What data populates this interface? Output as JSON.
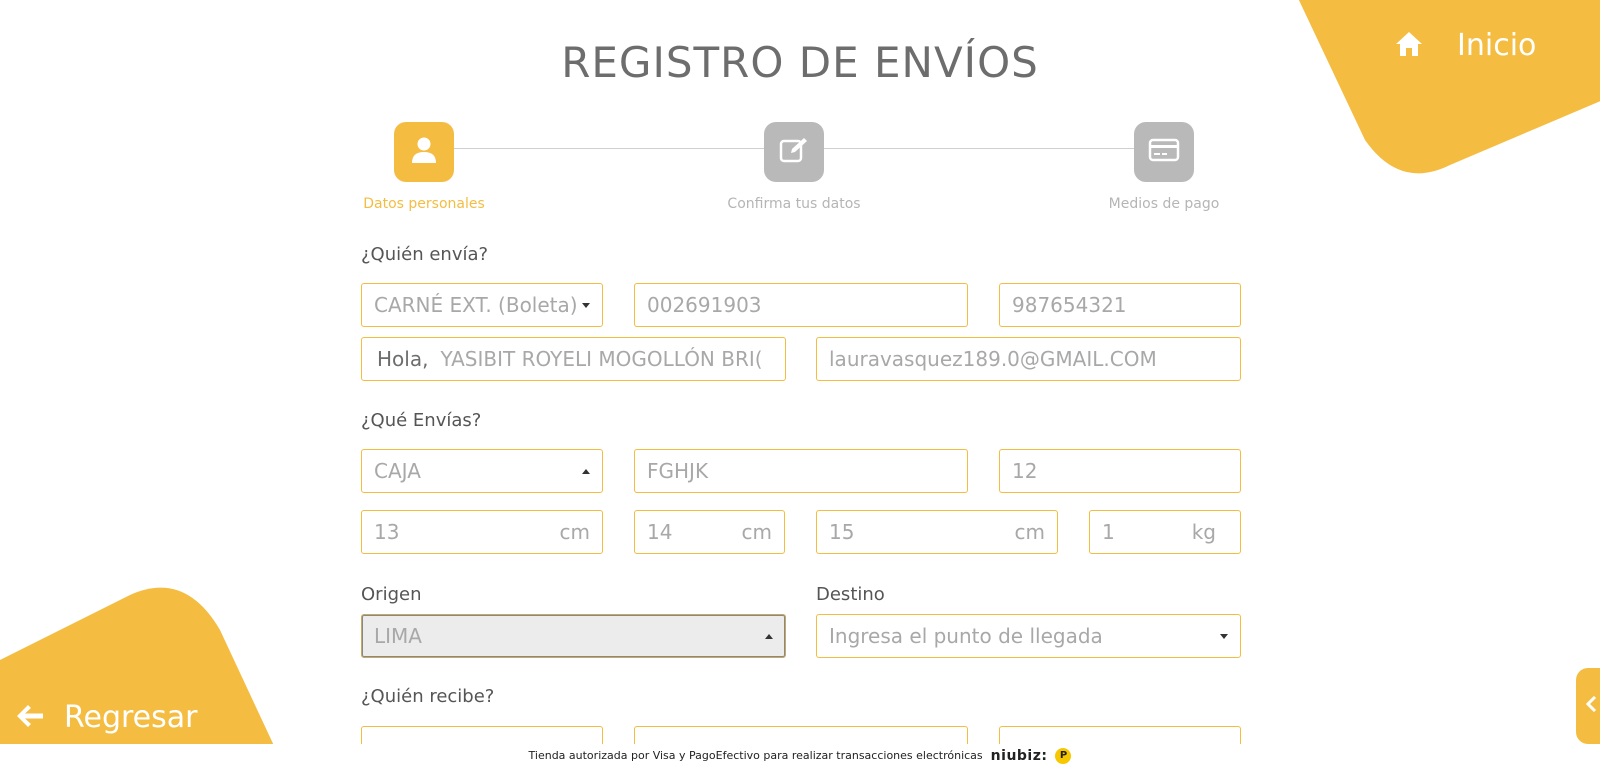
{
  "header": {
    "title": "REGISTRO DE ENVÍOS",
    "home_label": "Inicio"
  },
  "nav": {
    "back_label": "Regresar"
  },
  "steps": [
    {
      "label": "Datos personales",
      "icon": "user-icon",
      "state": "active"
    },
    {
      "label": "Confirma tus datos",
      "icon": "edit-icon",
      "state": "inactive"
    },
    {
      "label": "Medios de pago",
      "icon": "credit-card-icon",
      "state": "inactive"
    }
  ],
  "sender": {
    "section_label": "¿Quién envía?",
    "doc_type": "CARNÉ EXT. (Boleta)",
    "doc_number": "002691903",
    "phone": "987654321",
    "greeting": "Hola,",
    "name": "YASIBIT ROYELI MOGOLLÓN BRI(",
    "email": "lauravasquez189.0@GMAIL.COM"
  },
  "package": {
    "section_label": "¿Qué Envías?",
    "type": "CAJA",
    "description": "FGHJK",
    "quantity": "12",
    "length": "13",
    "length_unit": "cm",
    "width": "14",
    "width_unit": "cm",
    "height": "15",
    "height_unit": "cm",
    "weight": "1",
    "weight_unit": "kg"
  },
  "route": {
    "origin_label": "Origen",
    "origin_value": "LIMA",
    "destination_label": "Destino",
    "destination_placeholder": "Ingresa el punto de llegada"
  },
  "receiver": {
    "section_label": "¿Quién recibe?"
  },
  "footer": {
    "text": "Tienda autorizada por Visa y PagoEfectivo para realizar transacciones electrónicas",
    "brand": "niubiz:",
    "pe_mark": "P"
  },
  "colors": {
    "accent": "#f4bd42",
    "inactive": "#b9b9b9",
    "text": "#6d6d6d"
  }
}
